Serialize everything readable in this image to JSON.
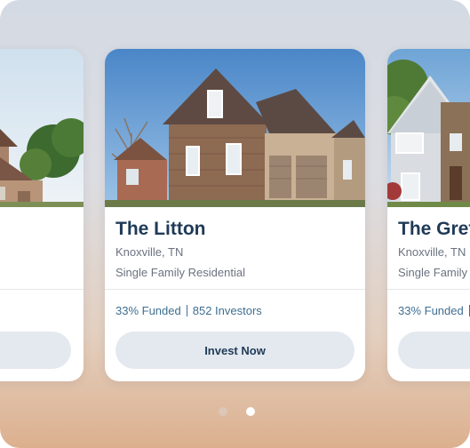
{
  "carousel": {
    "cards": [
      {
        "title": "",
        "location": "",
        "property_type": "",
        "funded": "",
        "investors": "",
        "button_label": ""
      },
      {
        "title": "The Litton",
        "location": "Knoxville, TN",
        "property_type": "Single Family Residential",
        "funded": "33% Funded",
        "investors": "852 Investors",
        "button_label": "Invest Now"
      },
      {
        "title": "The Gret",
        "location": "Knoxville, TN",
        "property_type": "Single Family R",
        "funded": "33% Funded",
        "investors": "",
        "button_label": ""
      }
    ],
    "active_page": 2,
    "page_count": 2
  },
  "colors": {
    "title": "#1f3a57",
    "stats": "#3f6f91",
    "button_bg": "#e4e9ef",
    "muted_text": "#6b7280"
  }
}
